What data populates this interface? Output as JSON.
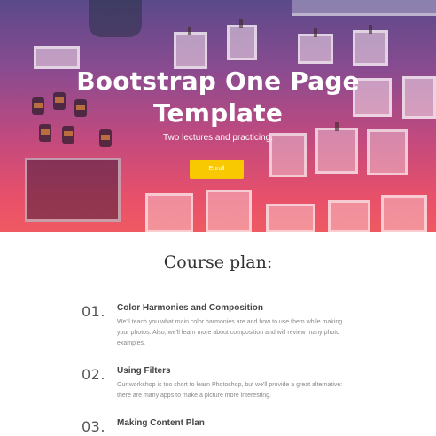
{
  "hero": {
    "title_line1": "Bootstrap One Page",
    "title_line2": "Template",
    "subtitle": "Two lectures and practicing.",
    "enroll_label": "Enroll"
  },
  "course": {
    "title": "Course plan:",
    "items": [
      {
        "number": "01.",
        "heading": "Color Harmonies and Composition",
        "text": "We'll teach you what main color harmonies are and how to use them while making your photos. Also, we'll learn more about composition and will review many photo examples."
      },
      {
        "number": "02.",
        "heading": "Using Filters",
        "text": "Our workshop is too short to learn Photoshop, but we'll provide a great alternative: there are many apps to make a picture more interesting."
      },
      {
        "number": "03.",
        "heading": "Making Content Plan",
        "text": ""
      }
    ]
  },
  "colors": {
    "accent_button": "#f8c800",
    "hero_gradient_top": "#5a4a8a",
    "hero_gradient_bottom": "#ee5a62"
  }
}
